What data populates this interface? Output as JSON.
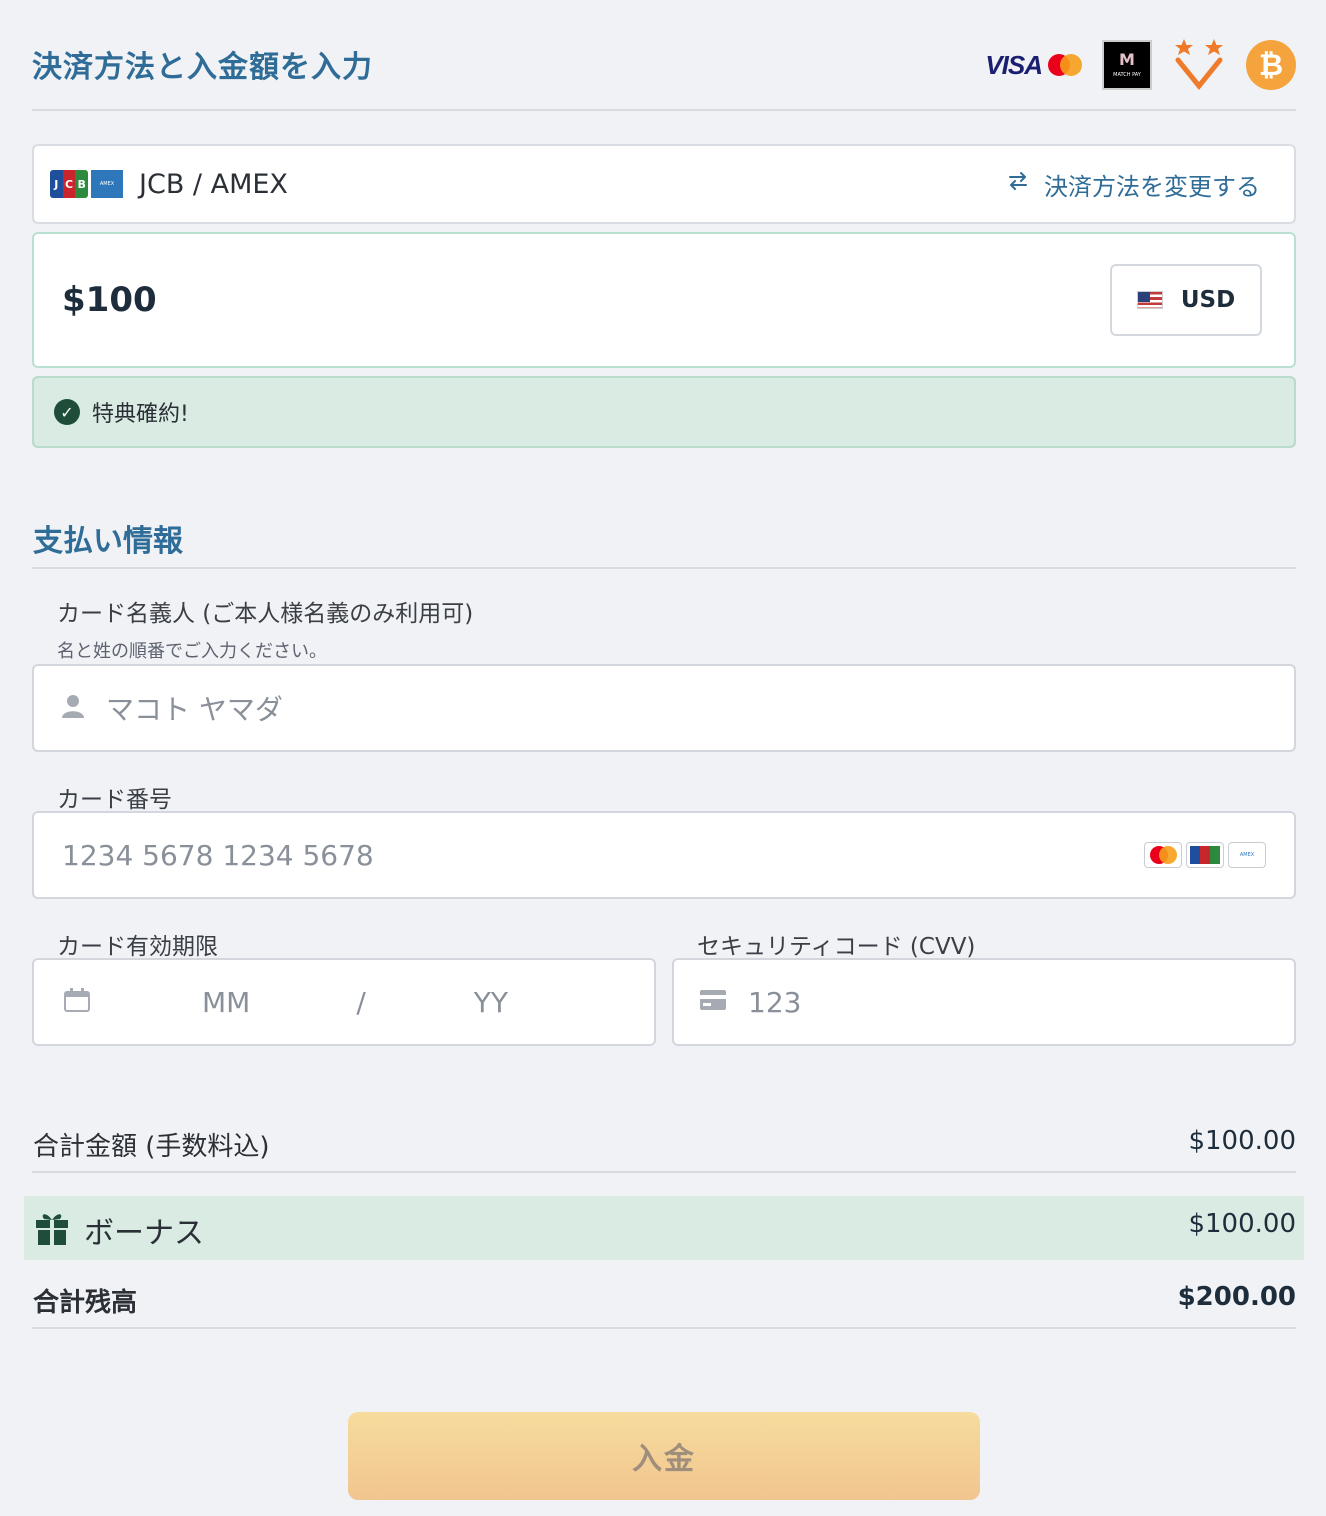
{
  "header": {
    "title": "決済方法と入金額を入力",
    "logos": {
      "visa": "VISA",
      "matchpay": "MATCH PAY",
      "btc": "₿"
    }
  },
  "method": {
    "label": "JCB / AMEX",
    "change_label": "決済方法を変更する"
  },
  "amount": {
    "value": "$100",
    "currency": "USD"
  },
  "confirm": {
    "text": "特典確約!"
  },
  "payment": {
    "title": "支払い情報",
    "holder_label": "カード名義人 (ご本人様名義のみ利用可)",
    "holder_hint": "名と姓の順番でご入力ください。",
    "holder_placeholder": "マコト ヤマダ",
    "number_label": "カード番号",
    "number_placeholder": "1234 5678 1234 5678",
    "expiry_label": "カード有効期限",
    "expiry_month_placeholder": "MM",
    "expiry_sep": "/",
    "expiry_year_placeholder": "YY",
    "cvv_label": "セキュリティコード (CVV)",
    "cvv_placeholder": "123"
  },
  "totals": {
    "subtotal_label": "合計金額 (手数料込)",
    "subtotal_value": "$100.00",
    "bonus_label": "ボーナス",
    "bonus_value": "$100.00",
    "balance_label": "合計残高",
    "balance_value": "$200.00"
  },
  "deposit_label": "入金",
  "colors": {
    "accent": "#2f6c97",
    "success_bg": "#d9ebe2",
    "button_top": "#f6dc9e",
    "button_bottom": "#f1c58f"
  }
}
